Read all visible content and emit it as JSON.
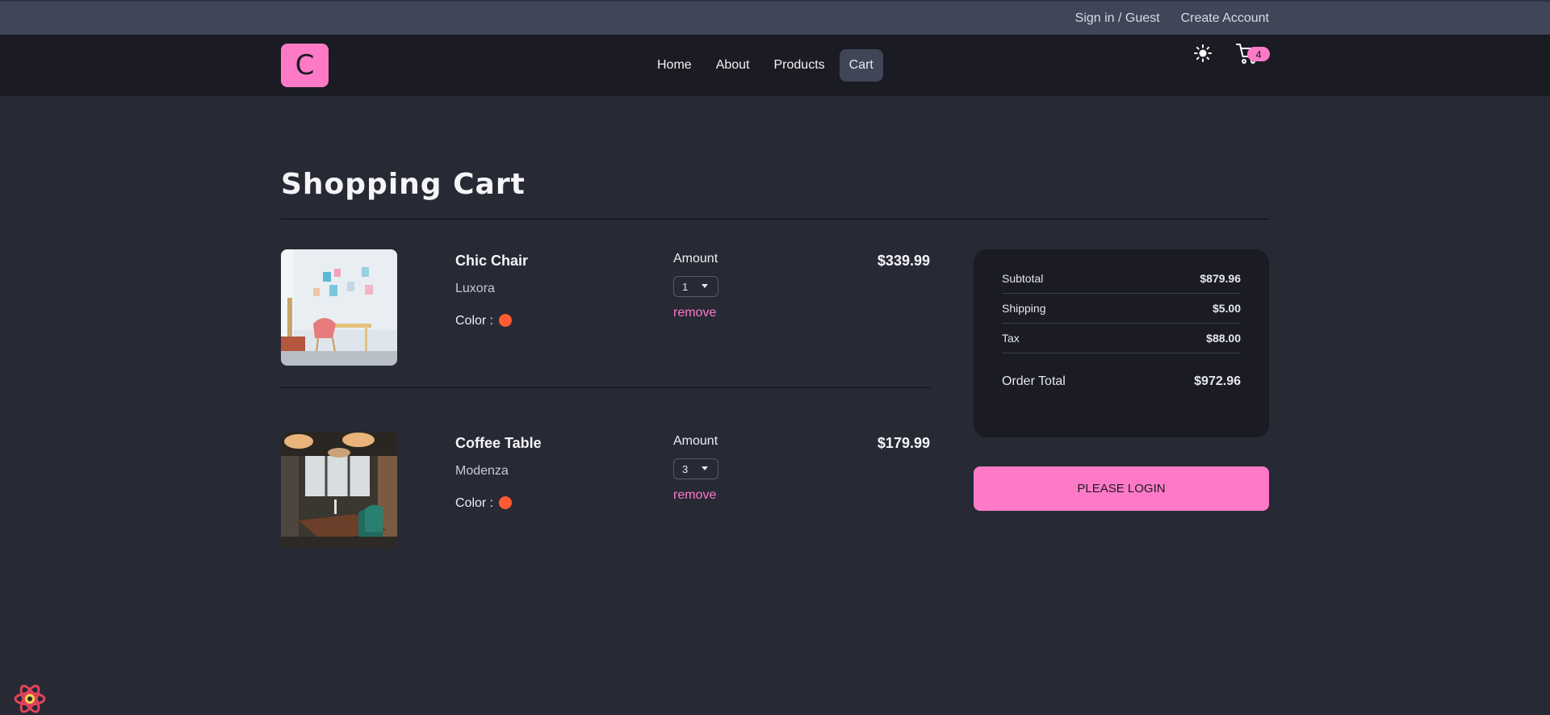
{
  "topbar": {
    "sign_in": "Sign in / Guest",
    "create_account": "Create Account"
  },
  "navbar": {
    "logo_letter": "C",
    "links": [
      {
        "label": "Home"
      },
      {
        "label": "About"
      },
      {
        "label": "Products"
      },
      {
        "label": "Cart"
      }
    ],
    "active_link": "Cart",
    "theme_icon": "sun-icon",
    "cart_icon": "cart-icon",
    "cart_count": "4"
  },
  "page": {
    "title": "Shopping Cart"
  },
  "cart": {
    "items": [
      {
        "name": "Chic Chair",
        "brand": "Luxora",
        "color_label": "Color :",
        "color": "#ff5a31",
        "amount_label": "Amount",
        "amount": "1",
        "remove_label": "remove",
        "price": "$339.99"
      },
      {
        "name": "Coffee Table",
        "brand": "Modenza",
        "color_label": "Color :",
        "color": "#ff5a31",
        "amount_label": "Amount",
        "amount": "3",
        "remove_label": "remove",
        "price": "$179.99"
      }
    ]
  },
  "summary": {
    "subtotal_label": "Subtotal",
    "subtotal": "$879.96",
    "shipping_label": "Shipping",
    "shipping": "$5.00",
    "tax_label": "Tax",
    "tax": "$88.00",
    "total_label": "Order Total",
    "total": "$972.96",
    "login_button": "PLEASE LOGIN"
  },
  "colors": {
    "accent": "#ff7ac6",
    "background": "#272935",
    "navbar": "#1a1b23",
    "topbar": "#414558"
  }
}
